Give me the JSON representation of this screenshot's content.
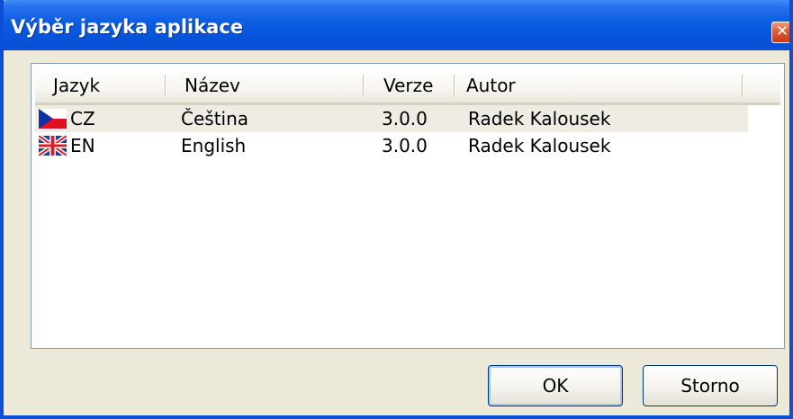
{
  "window": {
    "title": "Výběr jazyka aplikace",
    "close_symbol": "✕"
  },
  "list": {
    "columns": [
      "Jazyk",
      "Název",
      "Verze",
      "Autor"
    ],
    "rows": [
      {
        "flag_icon": "czech-flag-icon",
        "code": "CZ",
        "name": "Čeština",
        "version": "3.0.0",
        "author": "Radek Kalousek",
        "selected": true
      },
      {
        "flag_icon": "uk-flag-icon",
        "code": "EN",
        "name": "English",
        "version": "3.0.0",
        "author": "Radek Kalousek",
        "selected": false
      }
    ]
  },
  "buttons": {
    "ok": "OK",
    "cancel": "Storno"
  },
  "colors": {
    "titlebar": "#0a5ce0",
    "dialog_bg": "#ece9d8",
    "selected_row": "#efece4"
  }
}
